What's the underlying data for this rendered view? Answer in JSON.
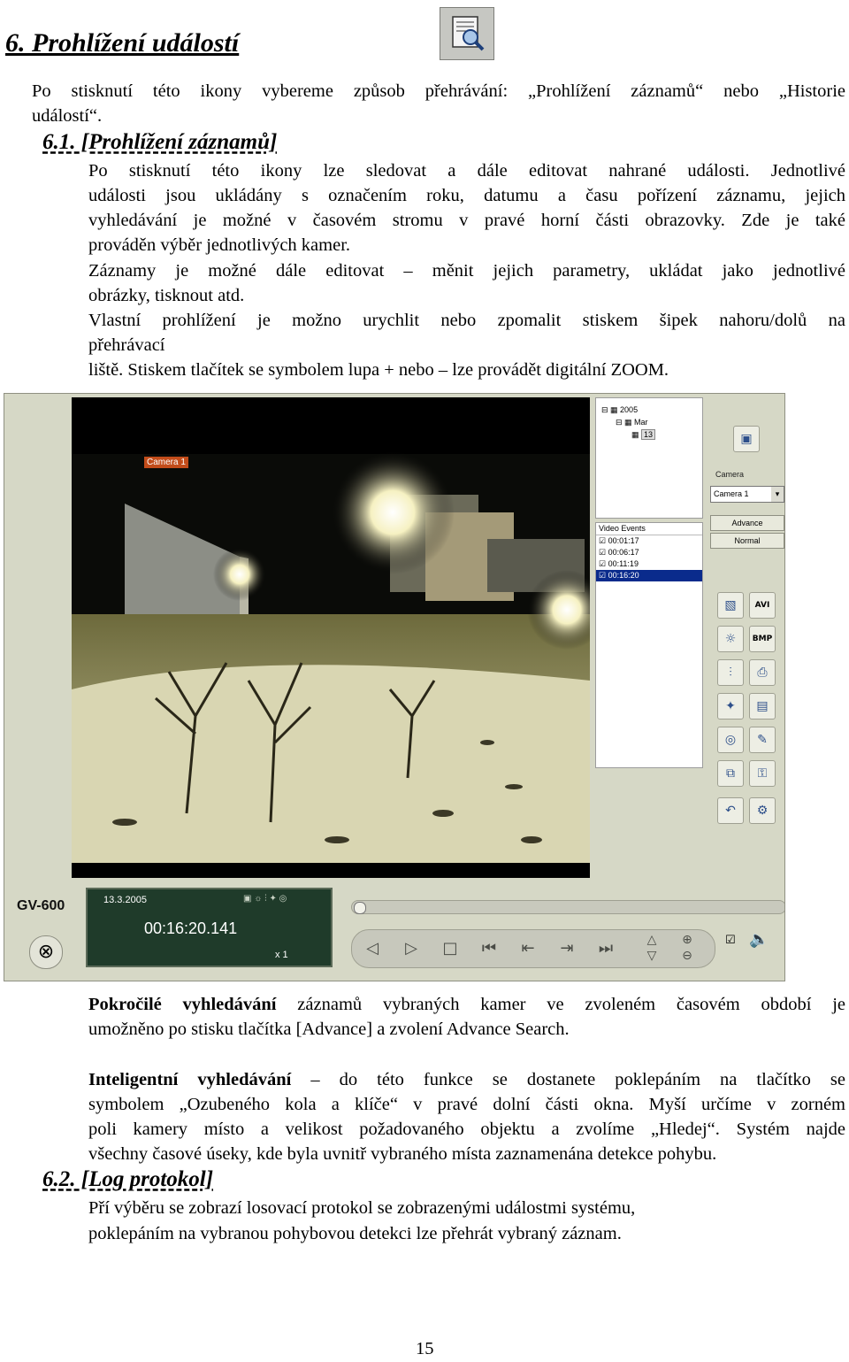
{
  "heading": "6. Prohlížení událostí",
  "intro": [
    "Po stisknutí této ikony vybereme způsob přehrávání: „Prohlížení záznamů“ nebo „Historie",
    "událostí“."
  ],
  "section1": {
    "title": "6.1. [Prohlížení záznamů]",
    "lines": [
      "Po stisknutí této ikony lze sledovat a dále editovat nahrané události. Jednotlivé",
      "události jsou ukládány s označením roku, datumu a času pořízení záznamu, jejich",
      "vyhledávání je možné v časovém stromu v pravé horní části obrazovky. Zde je také",
      "prováděn výběr jednotlivých kamer.",
      "Záznamy je možné dále editovat – měnit jejich parametry, ukládat jako jednotlivé",
      "obrázky, tisknout atd.",
      "Vlastní prohlížení je možno urychlit nebo zpomalit stiskem šipek nahoru/dolů na",
      "přehrávací",
      "liště. Stiskem tlačítek se symbolem lupa + nebo – lze provádět digitální ZOOM."
    ]
  },
  "screenshot": {
    "camera_overlay": "Camera 1",
    "tree": {
      "year": "2005",
      "month": "Mar",
      "day": "13"
    },
    "events": {
      "header": "Video Events",
      "items": [
        "00:01:17",
        "00:06:17",
        "00:11:19",
        "00:16:20"
      ],
      "selected_index": 3
    },
    "camera_label": "Camera",
    "camera_select": "Camera 1",
    "advance_label": "Advance",
    "normal_label": "Normal",
    "icon_labels": {
      "avi": "AVI",
      "bmp": "BMP"
    },
    "brand": "GV-600",
    "date": "13.3.2005",
    "time": "00:16:20.141",
    "speed": "x 1"
  },
  "para_advanced": {
    "bold": "Pokročilé vyhledávání",
    "rest": " záznamů vybraných kamer ve zvoleném časovém období je",
    "line2": "umožněno po stisku tlačítka [Advance] a zvolení Advance Search."
  },
  "para_intel": {
    "bold": "Inteligentní vyhledávání",
    "rest": " – do této funkce se dostanete poklepáním na tlačítko se",
    "lines": [
      "symbolem „Ozubeného kola a klíče“ v pravé dolní části okna. Myší určíme  v zorném",
      "poli kamery místo a velikost požadovaného objektu a zvolíme „Hledej“. Systém najde",
      "všechny časové úseky, kde byla uvnitř vybraného místa zaznamenána detekce pohybu."
    ]
  },
  "section2": {
    "title": "6.2. [Log protokol]",
    "lines": [
      "Pří výběru se zobrazí losovací protokol se zobrazenými událostmi systému,",
      "poklepáním na vybranou pohybovou detekci lze přehrát vybraný záznam."
    ]
  },
  "page_number": "15",
  "colors": {
    "lcd": "#1f3b2a",
    "selected": "#0a2b8c",
    "panel": "#d6d8c6"
  }
}
